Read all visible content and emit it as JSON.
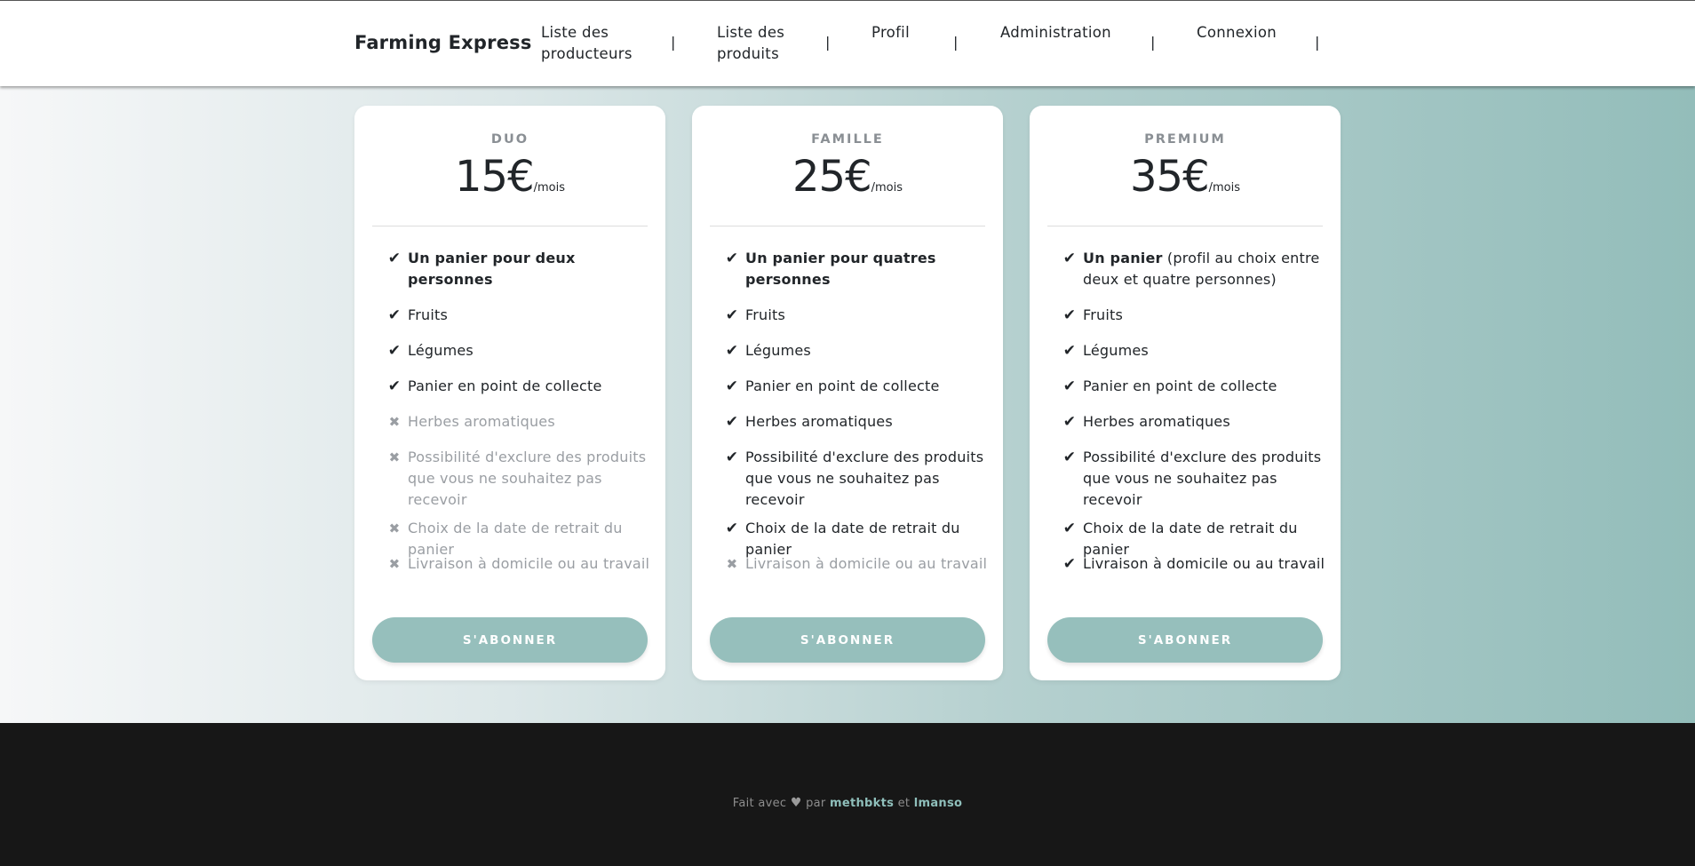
{
  "navbar": {
    "brand": "Farming Express",
    "items": [
      {
        "line1": "Liste des",
        "line2": "producteurs"
      },
      {
        "line1": "Liste des",
        "line2": "produits"
      },
      {
        "line1": "Profil",
        "line2": ""
      },
      {
        "line1": "Administration",
        "line2": ""
      },
      {
        "line1": "Connexion",
        "line2": ""
      }
    ],
    "separator": "|"
  },
  "plans": [
    {
      "title": "DUO",
      "price": "15€",
      "period": "/mois",
      "button": "S'ABONNER",
      "features": [
        {
          "bold": "Un panier pour deux personnes",
          "text": "",
          "included": true
        },
        {
          "bold": "",
          "text": "Fruits",
          "included": true
        },
        {
          "bold": "",
          "text": "Légumes",
          "included": true
        },
        {
          "bold": "",
          "text": "Panier en point de collecte",
          "included": true
        },
        {
          "bold": "",
          "text": "Herbes aromatiques",
          "included": false
        },
        {
          "bold": "",
          "text": "Possibilité d'exclure des produits que vous ne souhaitez pas recevoir",
          "included": false
        },
        {
          "bold": "",
          "text": "Choix de la date de retrait du panier",
          "included": false
        },
        {
          "bold": "",
          "text": "Livraison à domicile ou au travail",
          "included": false
        }
      ]
    },
    {
      "title": "FAMILLE",
      "price": "25€",
      "period": "/mois",
      "button": "S'ABONNER",
      "features": [
        {
          "bold": "Un panier pour quatres personnes",
          "text": "",
          "included": true
        },
        {
          "bold": "",
          "text": "Fruits",
          "included": true
        },
        {
          "bold": "",
          "text": "Légumes",
          "included": true
        },
        {
          "bold": "",
          "text": "Panier en point de collecte",
          "included": true
        },
        {
          "bold": "",
          "text": "Herbes aromatiques",
          "included": true
        },
        {
          "bold": "",
          "text": "Possibilité d'exclure des produits que vous ne souhaitez pas recevoir",
          "included": true
        },
        {
          "bold": "",
          "text": "Choix de la date de retrait du panier",
          "included": true
        },
        {
          "bold": "",
          "text": "Livraison à domicile ou au travail",
          "included": false
        }
      ]
    },
    {
      "title": "PREMIUM",
      "price": "35€",
      "period": "/mois",
      "button": "S'ABONNER",
      "features": [
        {
          "bold": "Un panier",
          "text": " (profil au choix entre deux et quatre personnes)",
          "included": true
        },
        {
          "bold": "",
          "text": "Fruits",
          "included": true
        },
        {
          "bold": "",
          "text": "Légumes",
          "included": true
        },
        {
          "bold": "",
          "text": "Panier en point de collecte",
          "included": true
        },
        {
          "bold": "",
          "text": "Herbes aromatiques",
          "included": true
        },
        {
          "bold": "",
          "text": "Possibilité d'exclure des produits que vous ne souhaitez pas recevoir",
          "included": true
        },
        {
          "bold": "",
          "text": "Choix de la date de retrait du panier",
          "included": true
        },
        {
          "bold": "",
          "text": "Livraison à domicile ou au travail",
          "included": true
        }
      ]
    }
  ],
  "icons": {
    "included": "check-icon",
    "excluded": "cross-icon",
    "footer": "heart-icon"
  },
  "footer": {
    "prefix": "Fait avec",
    "middle": "par",
    "author1": "methbkts",
    "conj": "et",
    "author2": "lmanso"
  },
  "colors": {
    "accent": "#96bfbc",
    "footer_bg": "#171717",
    "link": "#8fbfbb",
    "muted": "#9a9ea3"
  }
}
